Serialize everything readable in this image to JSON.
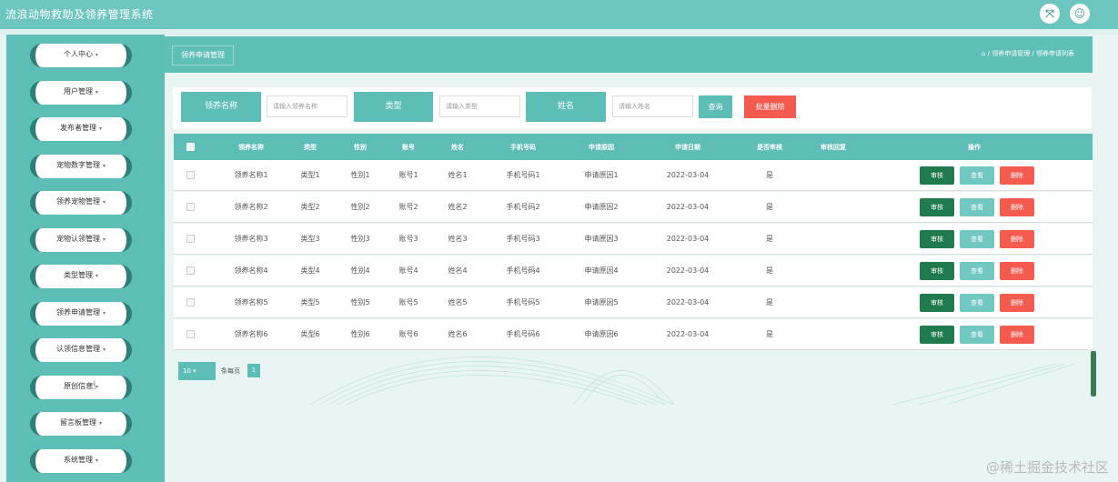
{
  "app": {
    "title": "流浪动物救助及领养管理系统"
  },
  "header_icons": [
    {
      "name": "fullscreen-icon",
      "glyph": "⤧"
    },
    {
      "name": "user-icon",
      "glyph": "☺"
    }
  ],
  "sidebar": {
    "items": [
      {
        "label": "个人中心"
      },
      {
        "label": "用户管理"
      },
      {
        "label": "发布者管理"
      },
      {
        "label": "宠物数字管理"
      },
      {
        "label": "领养宠物管理"
      },
      {
        "label": "宠物认领管理"
      },
      {
        "label": "类型管理"
      },
      {
        "label": "领养申请管理"
      },
      {
        "label": "认领信息管理"
      },
      {
        "label": "原创信息"
      },
      {
        "label": "留言板管理"
      },
      {
        "label": "系统管理"
      }
    ],
    "arrow": "▾"
  },
  "main": {
    "tab_label": "领养申请管理",
    "breadcrumb": "⌂ / 领养申请管理 / 领养申请列表"
  },
  "search": {
    "fields": [
      {
        "label": "领养名称",
        "placeholder": "请输入领养名称"
      },
      {
        "label": "类型",
        "placeholder": "请输入类型"
      },
      {
        "label": "姓名",
        "placeholder": "请输入姓名"
      }
    ],
    "query_button": "查询",
    "batch_delete_button": "批量删除"
  },
  "table": {
    "columns": [
      "领养名称",
      "类型",
      "性别",
      "账号",
      "姓名",
      "手机号码",
      "申请原因",
      "申请日期",
      "是否审核",
      "审核回复",
      "操作"
    ],
    "rows": [
      {
        "name": "领养名称1",
        "type": "类型1",
        "gender": "性别1",
        "account": "账号1",
        "person": "姓名1",
        "phone": "手机号码1",
        "reason": "申请原因1",
        "date": "2022-03-04",
        "reviewed": "是"
      },
      {
        "name": "领养名称2",
        "type": "类型2",
        "gender": "性别2",
        "account": "账号2",
        "person": "姓名2",
        "phone": "手机号码2",
        "reason": "申请原因2",
        "date": "2022-03-04",
        "reviewed": "是"
      },
      {
        "name": "领养名称3",
        "type": "类型3",
        "gender": "性别3",
        "account": "账号3",
        "person": "姓名3",
        "phone": "手机号码3",
        "reason": "申请原因3",
        "date": "2022-03-04",
        "reviewed": "是"
      },
      {
        "name": "领养名称4",
        "type": "类型4",
        "gender": "性别4",
        "account": "账号4",
        "person": "姓名4",
        "phone": "手机号码4",
        "reason": "申请原因4",
        "date": "2022-03-04",
        "reviewed": "是"
      },
      {
        "name": "领养名称5",
        "type": "类型5",
        "gender": "性别5",
        "account": "账号5",
        "person": "姓名5",
        "phone": "手机号码5",
        "reason": "申请原因5",
        "date": "2022-03-04",
        "reviewed": "是"
      },
      {
        "name": "领养名称6",
        "type": "类型6",
        "gender": "性别6",
        "account": "账号6",
        "person": "姓名6",
        "phone": "手机号码6",
        "reason": "申请原因6",
        "date": "2022-03-04",
        "reviewed": "是"
      }
    ],
    "actions": {
      "audit": "审核",
      "view": "查看",
      "delete": "删除"
    }
  },
  "pager": {
    "page_size": "10",
    "total_text": "条每页",
    "current_page": "1"
  },
  "watermark": "@稀土掘金技术社区",
  "colors": {
    "primary": "#5dbdb7",
    "header": "#6cc5bf",
    "audit": "#1f7a4d",
    "view": "#71c7c1",
    "delete": "#f55a4e"
  }
}
